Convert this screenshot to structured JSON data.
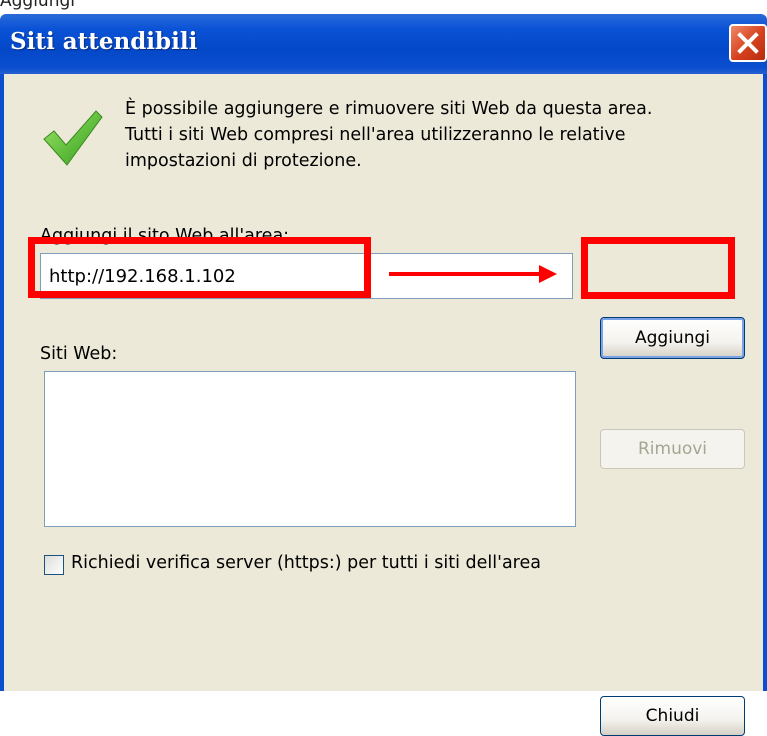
{
  "dialog": {
    "title": "Siti attendibili",
    "message_line1": "È possibile aggiungere e rimuovere siti Web da questa area.",
    "message_line2": "Tutti i siti Web compresi nell'area utilizzeranno le relative",
    "message_line3": "impostazioni di protezione.",
    "add_site_label": "Aggiungi il sito Web all'area:",
    "url_value": "http://192.168.1.102",
    "add_button": "Aggiungi",
    "sites_label": "Siti Web:",
    "remove_button": "Rimuovi",
    "require_https_label": "Richiedi verifica server (https:) per tutti i siti dell'area",
    "require_https_checked": false,
    "close_button": "Chiudi"
  },
  "top_cut_text": "Aggiungi",
  "icons": {
    "close": "close-icon",
    "check": "checkmark-icon",
    "arrow": "arrow-right-icon"
  },
  "colors": {
    "titlebar": "#0b4fd0",
    "client": "#ece9d8",
    "highlight": "#ff0000"
  }
}
